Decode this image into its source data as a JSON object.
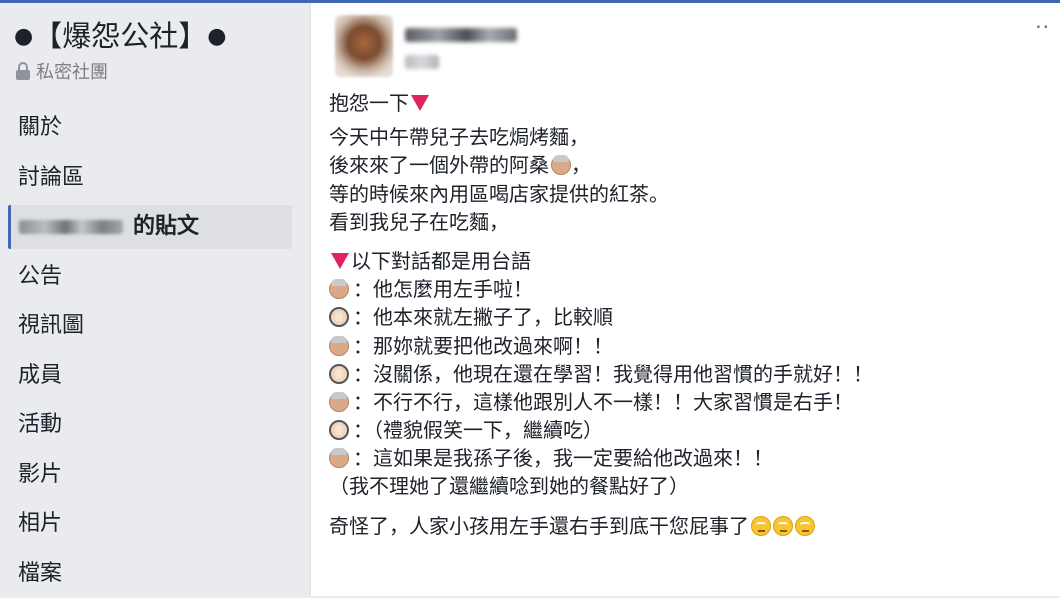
{
  "group": {
    "title": "【爆怨公社】",
    "privacy": "私密社團"
  },
  "nav": {
    "items": [
      {
        "label": "關於"
      },
      {
        "label": "討論區"
      },
      {
        "label": "的貼文",
        "active": true
      },
      {
        "label": "公告"
      },
      {
        "label": "視訊圖"
      },
      {
        "label": "成員"
      },
      {
        "label": "活動"
      },
      {
        "label": "影片"
      },
      {
        "label": "相片"
      },
      {
        "label": "檔案"
      }
    ]
  },
  "post": {
    "more": "··",
    "lines": [
      {
        "text": "抱怨一下",
        "icon_after": "red-triangle"
      },
      {
        "text": "今天中午帶兒子去吃焗烤麵，"
      },
      {
        "text": "後來來了一個外帶的阿桑",
        "icon_after": "grandma-emoji",
        "text_after": "，"
      },
      {
        "text": "等的時候來內用區喝店家提供的紅茶。"
      },
      {
        "text": "看到我兒子在吃麵，"
      },
      {
        "icon_before": "red-triangle",
        "text": "以下對話都是用台語"
      },
      {
        "icon_before": "grandma-emoji",
        "text": "：他怎麼用左手啦！"
      },
      {
        "icon_before": "mom-emoji",
        "text": "：他本來就左撇子了，比較順"
      },
      {
        "icon_before": "grandma-emoji",
        "text": "：那妳就要把他改過來啊！！"
      },
      {
        "icon_before": "mom-emoji",
        "text": "：沒關係，他現在還在學習！我覺得用他習慣的手就好！！"
      },
      {
        "icon_before": "grandma-emoji",
        "text": "：不行不行，這樣他跟別人不一樣！！大家習慣是右手！"
      },
      {
        "icon_before": "mom-emoji",
        "text": "：（禮貌假笑一下，繼續吃）"
      },
      {
        "icon_before": "grandma-emoji",
        "text": "：這如果是我孫子後，我一定要給他改過來！！"
      },
      {
        "text": "（我不理她了還繼續唸到她的餐點好了）"
      },
      {
        "text": "奇怪了，人家小孩用左手還右手到底干您屁事了",
        "icons_after": [
          "eye-roll-emoji",
          "eye-roll-emoji",
          "eye-roll-emoji"
        ]
      }
    ]
  },
  "colors": {
    "accent": "#4267b2",
    "background": "#e9ebee",
    "card": "#ffffff",
    "triangle": "#e0245e"
  }
}
